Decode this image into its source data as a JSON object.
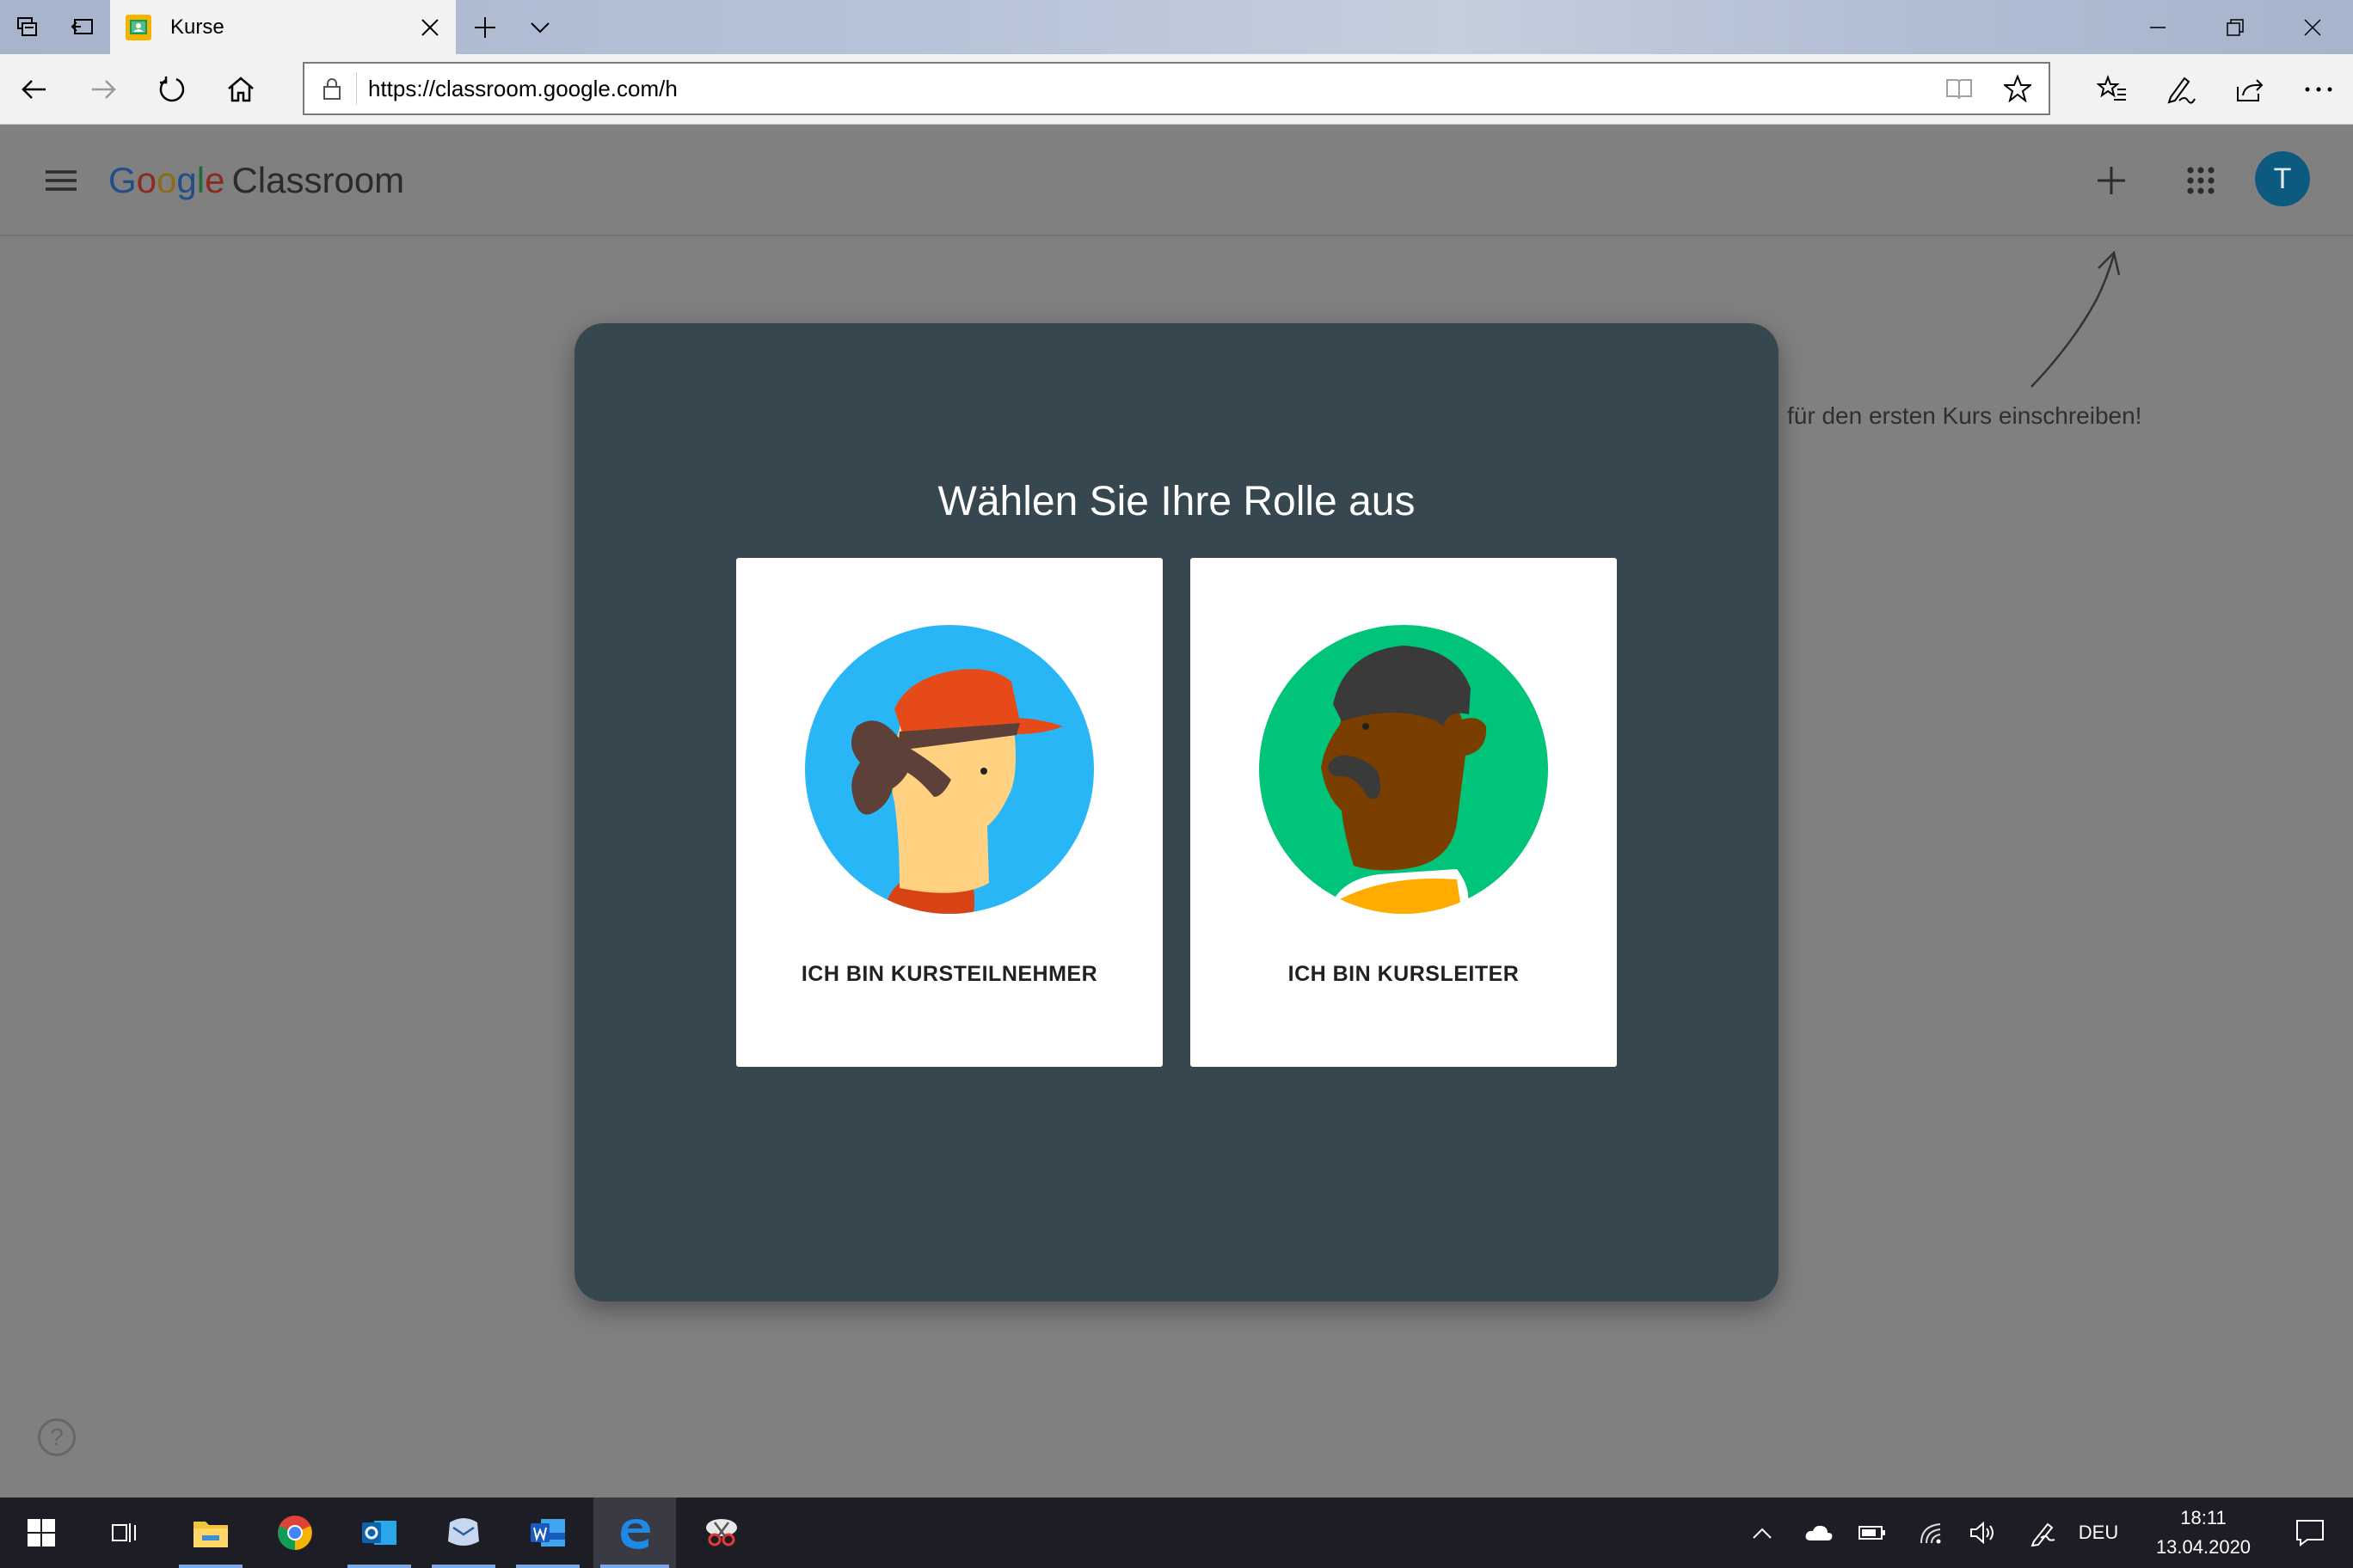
{
  "browser": {
    "tab_title": "Kurse",
    "url": "https://classroom.google.com/h"
  },
  "app": {
    "brand_google": [
      "G",
      "o",
      "o",
      "g",
      "l",
      "e"
    ],
    "brand_product": "Classroom",
    "avatar_initial": "T",
    "hint_text": "Kurs erstellen oder für den ersten Kurs einschreiben!",
    "hint_visible": "für den ersten Kurs einschreiben!",
    "help_glyph": "?"
  },
  "dialog": {
    "title": "Wählen Sie Ihre Rolle aus",
    "options": [
      {
        "label": "ICH BIN KURSTEILNEHMER"
      },
      {
        "label": "ICH BIN KURSLEITER"
      }
    ]
  },
  "taskbar": {
    "language": "DEU",
    "time": "18:11",
    "date": "13.04.2020"
  },
  "colors": {
    "dialog_bg": "#37474f",
    "overlay_bg": "#808080",
    "student_circle": "#29b6f6",
    "teacher_circle": "#00c47a",
    "avatar": "#0d5a80"
  }
}
